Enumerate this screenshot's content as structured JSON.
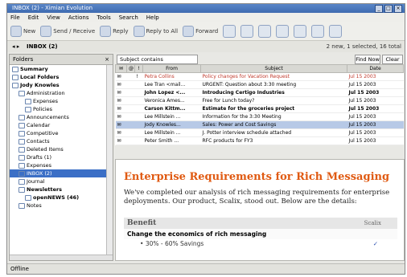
{
  "window": {
    "title": "INBOX (2) - Ximian Evolution"
  },
  "menu": [
    "File",
    "Edit",
    "View",
    "Actions",
    "Tools",
    "Search",
    "Help"
  ],
  "toolbar": {
    "new": "New",
    "send_receive": "Send / Receive",
    "reply": "Reply",
    "reply_all": "Reply to All",
    "forward": "Forward"
  },
  "location": {
    "name": "INBOX (2)",
    "status": "2 new, 1 selected, 16 total"
  },
  "folders": {
    "header": "Folders",
    "items": [
      {
        "label": "Summary",
        "indent": 0,
        "bold": true
      },
      {
        "label": "Local Folders",
        "indent": 0,
        "bold": true
      },
      {
        "label": "Jody Knowles",
        "indent": 0,
        "bold": true
      },
      {
        "label": "Administration",
        "indent": 1
      },
      {
        "label": "Expenses",
        "indent": 2
      },
      {
        "label": "Policies",
        "indent": 2
      },
      {
        "label": "Announcements",
        "indent": 1
      },
      {
        "label": "Calendar",
        "indent": 1
      },
      {
        "label": "Competitive",
        "indent": 1
      },
      {
        "label": "Contacts",
        "indent": 1
      },
      {
        "label": "Deleted Items",
        "indent": 1
      },
      {
        "label": "Drafts (1)",
        "indent": 1
      },
      {
        "label": "Expenses",
        "indent": 1
      },
      {
        "label": "INBOX (2)",
        "indent": 1,
        "selected": true
      },
      {
        "label": "Journal",
        "indent": 1
      },
      {
        "label": "Newsletters",
        "indent": 1,
        "bold": true
      },
      {
        "label": "openNEWS (46)",
        "indent": 2,
        "bold": true
      },
      {
        "label": "Notes",
        "indent": 1
      }
    ]
  },
  "filter": {
    "field": "Subject contains",
    "find": "Find Now",
    "clear": "Clear"
  },
  "columns": {
    "from": "From",
    "subject": "Subject",
    "date": "Date"
  },
  "messages": [
    {
      "from": "Petra Collins",
      "subject": "Policy changes for Vacation Request",
      "date": "Jul 15 2003",
      "style": "red"
    },
    {
      "from": "Lee Tran <mail...",
      "subject": "URGENT: Question about 3:30 meeting",
      "date": "Jul 15 2003"
    },
    {
      "from": "John Lopez <...",
      "subject": "Introducing Certigo Industries",
      "date": "Jul 15 2003",
      "style": "unread"
    },
    {
      "from": "Veronica Ames...",
      "subject": "Free for Lunch today?",
      "date": "Jul 15 2003"
    },
    {
      "from": "Carson Kittm...",
      "subject": "Estimate for the groceries project",
      "date": "Jul 15 2003",
      "style": "unread"
    },
    {
      "from": "Lee Millstein ...",
      "subject": "Information for the 3:30 Meeting",
      "date": "Jul 15 2003"
    },
    {
      "from": "Jody Knowles...",
      "subject": "Sales: Power and Cost Savings",
      "date": "Jul 15 2003",
      "style": "sel"
    },
    {
      "from": "Lee Millstein ...",
      "subject": "J. Potter interview schedule attached",
      "date": "Jul 15 2003"
    },
    {
      "from": "Peter Smith ...",
      "subject": "RFC products for FY3",
      "date": "Jul 15 2003"
    }
  ],
  "preview": {
    "heading": "Enterprise Requirements for Rich Messaging",
    "body": "We've completed our analysis of rich messaging requirements for enterprise deployments. Our product, Scalix, stood out. Below are the details:",
    "table": {
      "title": "Benefit",
      "right": "Scalix",
      "group": "Change the economics of rich messaging",
      "items": [
        "30% - 60% Savings"
      ]
    }
  },
  "statusbar": {
    "text": "Offline"
  }
}
